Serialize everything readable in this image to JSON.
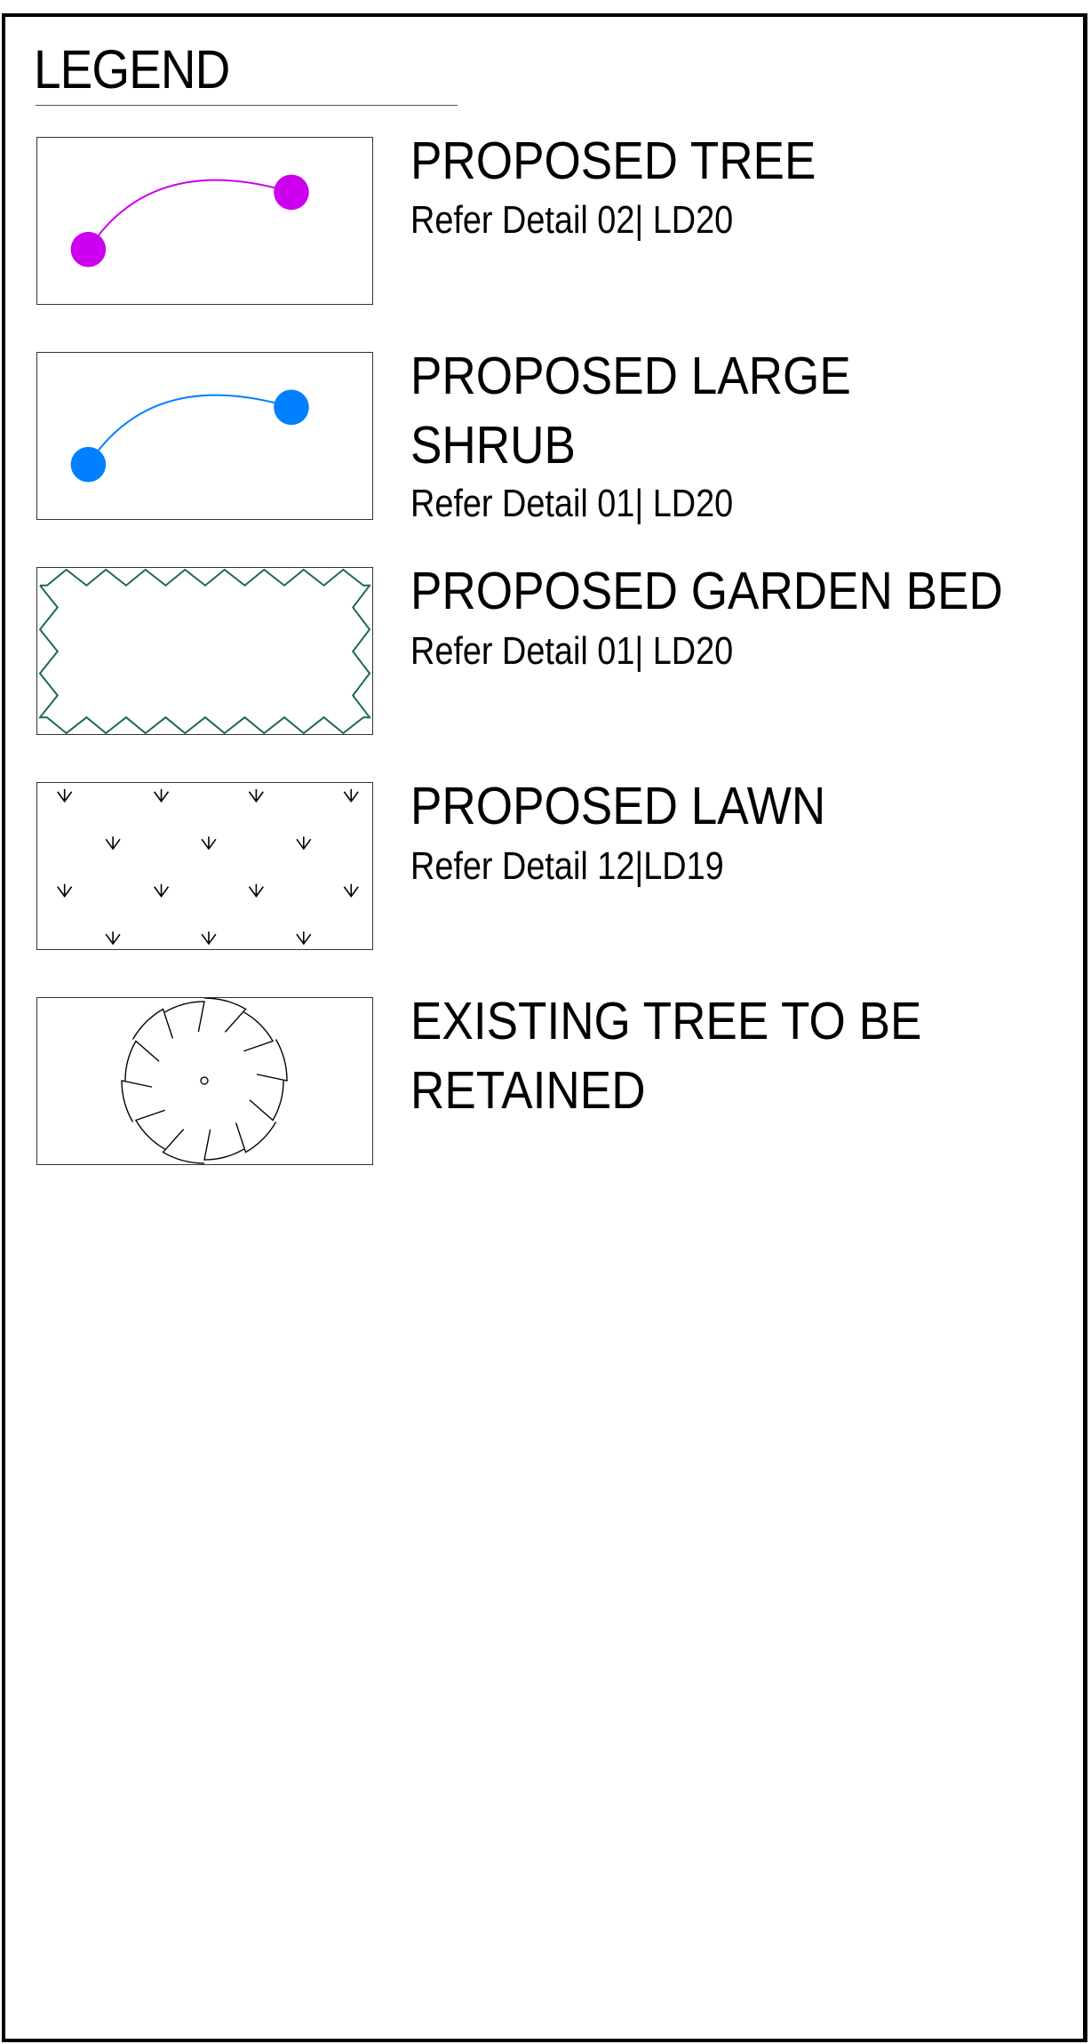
{
  "legend": {
    "title": "LEGEND",
    "items": [
      {
        "label_lines": [
          "PROPOSED TREE"
        ],
        "reference": "Refer Detail 02| LD20",
        "symbol": "tree-symbol-icon",
        "color": "#cc00ee"
      },
      {
        "label_lines": [
          "PROPOSED LARGE",
          "SHRUB"
        ],
        "reference": "Refer Detail 01| LD20",
        "symbol": "shrub-symbol-icon",
        "color": "#0080ff"
      },
      {
        "label_lines": [
          "PROPOSED GARDEN BED"
        ],
        "reference": "Refer Detail 01| LD20",
        "symbol": "garden-bed-hatch-icon",
        "color": "#1a6b4a"
      },
      {
        "label_lines": [
          "PROPOSED LAWN"
        ],
        "reference": "Refer Detail 12|LD19",
        "symbol": "lawn-hatch-icon",
        "color": "#000000"
      },
      {
        "label_lines": [
          "EXISTING TREE TO BE",
          "RETAINED"
        ],
        "reference": "",
        "symbol": "existing-tree-icon",
        "color": "#000000"
      }
    ]
  }
}
